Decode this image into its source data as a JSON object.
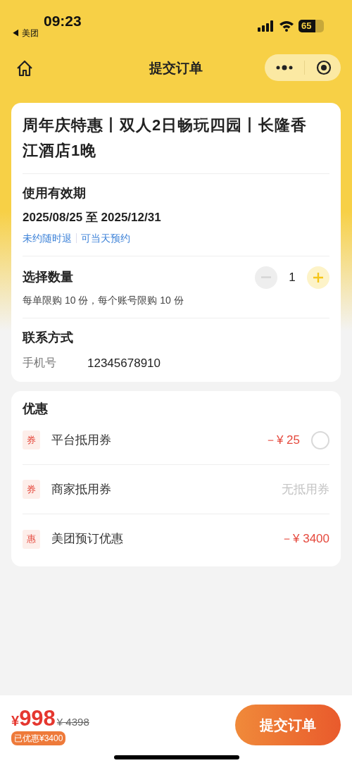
{
  "status_bar": {
    "time": "09:23",
    "back_app": "◀ 美团",
    "battery": "65"
  },
  "nav": {
    "title": "提交订单"
  },
  "product": {
    "title": "周年庆特惠丨双人2日畅玩四园丨长隆香江酒店1晚"
  },
  "validity": {
    "heading": "使用有效期",
    "dates": "2025/08/25 至 2025/12/31",
    "tags": [
      "未约随时退",
      "可当天预约"
    ]
  },
  "quantity": {
    "heading": "选择数量",
    "value": "1",
    "minus_disabled": true,
    "plus_disabled": false,
    "limit_note": "每单限购 10 份，每个账号限购 10 份"
  },
  "contact": {
    "heading": "联系方式",
    "label": "手机号",
    "value": "12345678910"
  },
  "discounts": {
    "heading": "优惠",
    "items": [
      {
        "kind": "coupon",
        "badge": "券",
        "label": "平台抵用券",
        "value": "－¥ 25",
        "checked": false
      },
      {
        "kind": "unavailable",
        "badge": "券",
        "label": "商家抵用券",
        "value": "无抵用券"
      },
      {
        "kind": "discount",
        "badge": "惠",
        "label": "美团预订优惠",
        "value": "－¥ 3400"
      }
    ]
  },
  "footer": {
    "currency": "¥",
    "price": "998",
    "original_price": "¥ 4398",
    "saved": "已优惠¥3400",
    "submit": "提交订单"
  }
}
